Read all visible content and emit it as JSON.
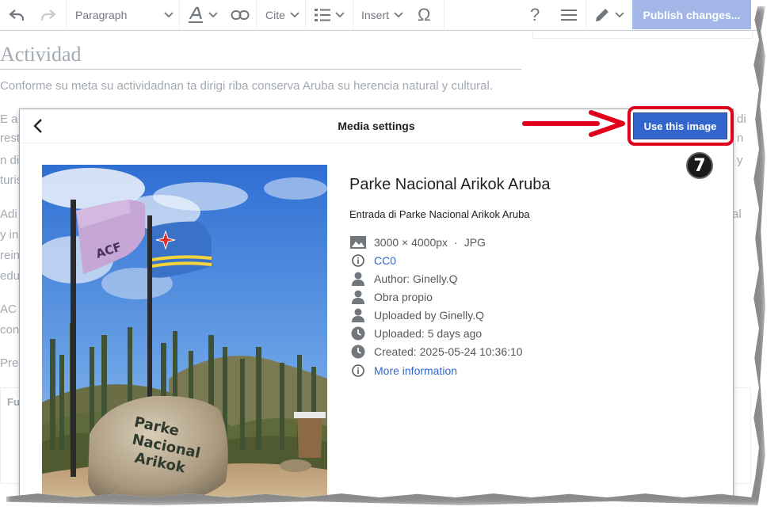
{
  "toolbar": {
    "format_label": "Paragraph",
    "cite_label": "Cite",
    "insert_label": "Insert",
    "publish_label": "Publish changes..."
  },
  "article": {
    "heading": "Actividad",
    "intro": "Conforme su meta su actividadnan ta dirigi riba conserva Aruba su herencia natural y cultural.",
    "fragments_left": [
      "E a",
      "rest",
      "n di",
      "turis",
      "Adi",
      "y in",
      "rein",
      "edu",
      "AC",
      "con",
      "Pre"
    ],
    "fragments_right": [
      "di",
      "n",
      "y",
      "al"
    ],
    "refbox_label": "Fu"
  },
  "dialog": {
    "title": "Media settings",
    "use_button": "Use this image",
    "image_title": "Parke Nacional Arikok Aruba",
    "description": "Entrada di Parke Nacional Arikok Aruba",
    "dimensions": "3000 × 4000px",
    "separator": "·",
    "format": "JPG",
    "license": "CC0",
    "author": "Author: Ginelly.Q",
    "source": "Obra propio",
    "uploaded_by": "Uploaded by Ginelly.Q",
    "uploaded": "Uploaded: 5 days ago",
    "created": "Created: 2025-05-24 10:36:10",
    "more_info": "More information",
    "photo": {
      "stone_text_1": "Parke",
      "stone_text_2": "Nacional",
      "stone_text_3": "Arikok",
      "flag_text": "ACF"
    }
  },
  "annotation": {
    "step_number": "7",
    "highlight_color": "#e0001b"
  },
  "colors": {
    "accent": "#3366cc",
    "publish_disabled": "#a2b7e8",
    "muted_text": "#a2a9b1"
  }
}
